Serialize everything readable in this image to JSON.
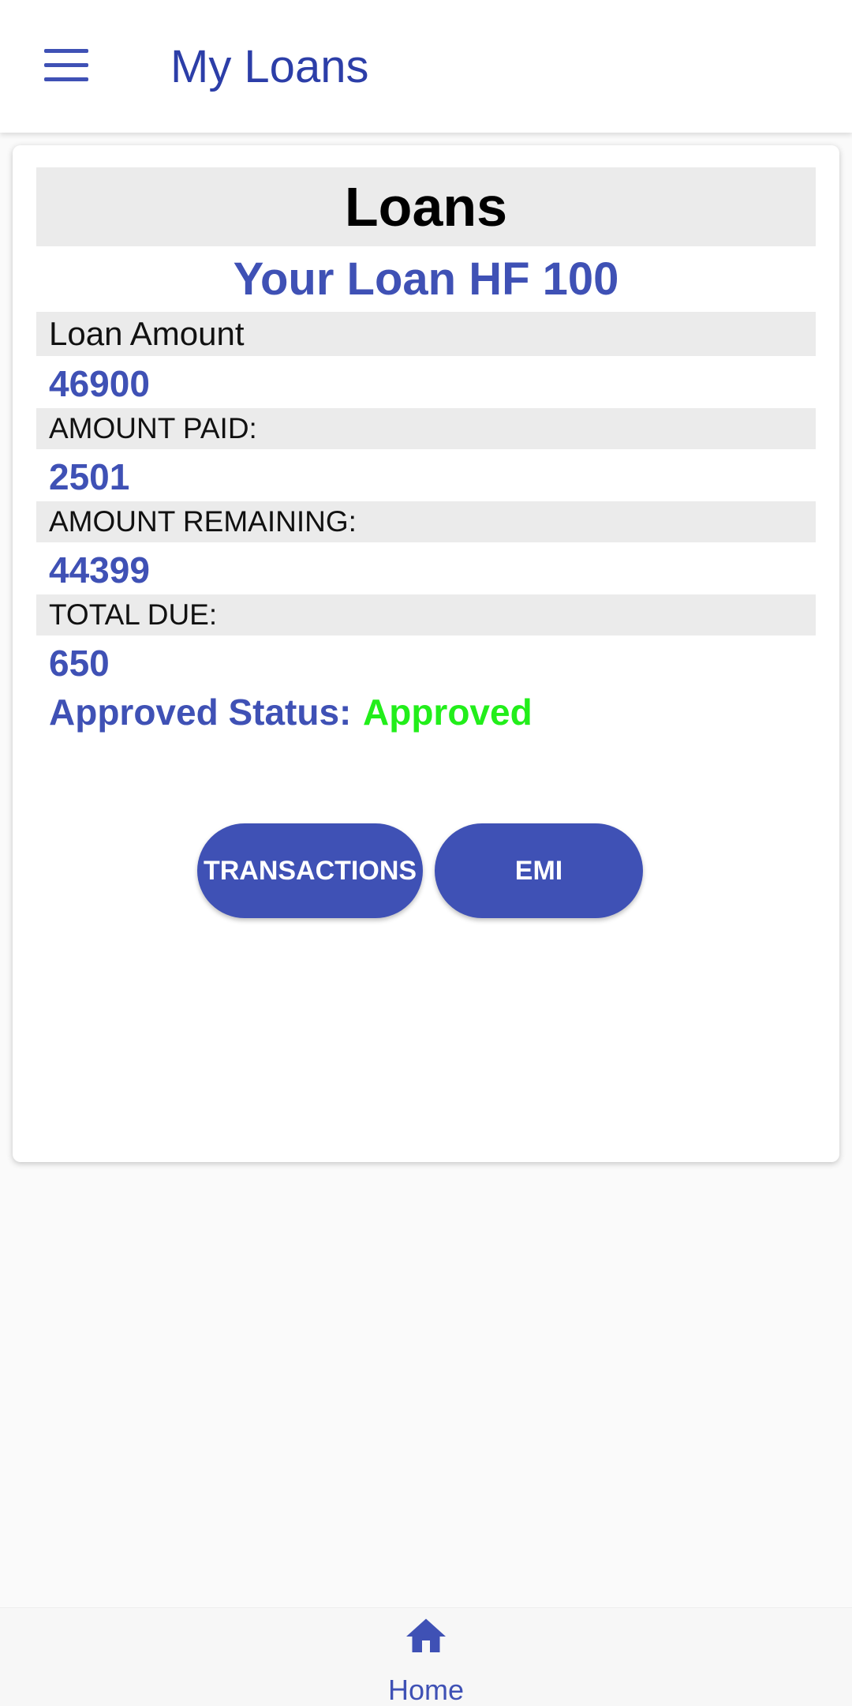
{
  "app_bar": {
    "title": "My Loans",
    "menu_icon": "hamburger-menu-icon"
  },
  "card": {
    "header": "Loans",
    "loan_name": "Your Loan HF 100",
    "fields": [
      {
        "label": "Loan Amount",
        "value": "46900"
      },
      {
        "label": "AMOUNT PAID:",
        "value": "2501"
      },
      {
        "label": "AMOUNT REMAINING:",
        "value": "44399"
      },
      {
        "label": "TOTAL DUE:",
        "value": "650"
      }
    ],
    "status_label": "Approved Status:",
    "status_value": "Approved",
    "buttons": {
      "transactions": "TRANSACTIONS",
      "emi": "EMI"
    }
  },
  "bottom_nav": {
    "items": [
      {
        "label": "Home",
        "icon": "home-icon"
      }
    ]
  },
  "colors": {
    "primary": "#3f51b5",
    "title": "#2c3ea8",
    "status_approved": "#22ee1a",
    "label_band": "#ebebeb",
    "background": "#fafafa"
  }
}
